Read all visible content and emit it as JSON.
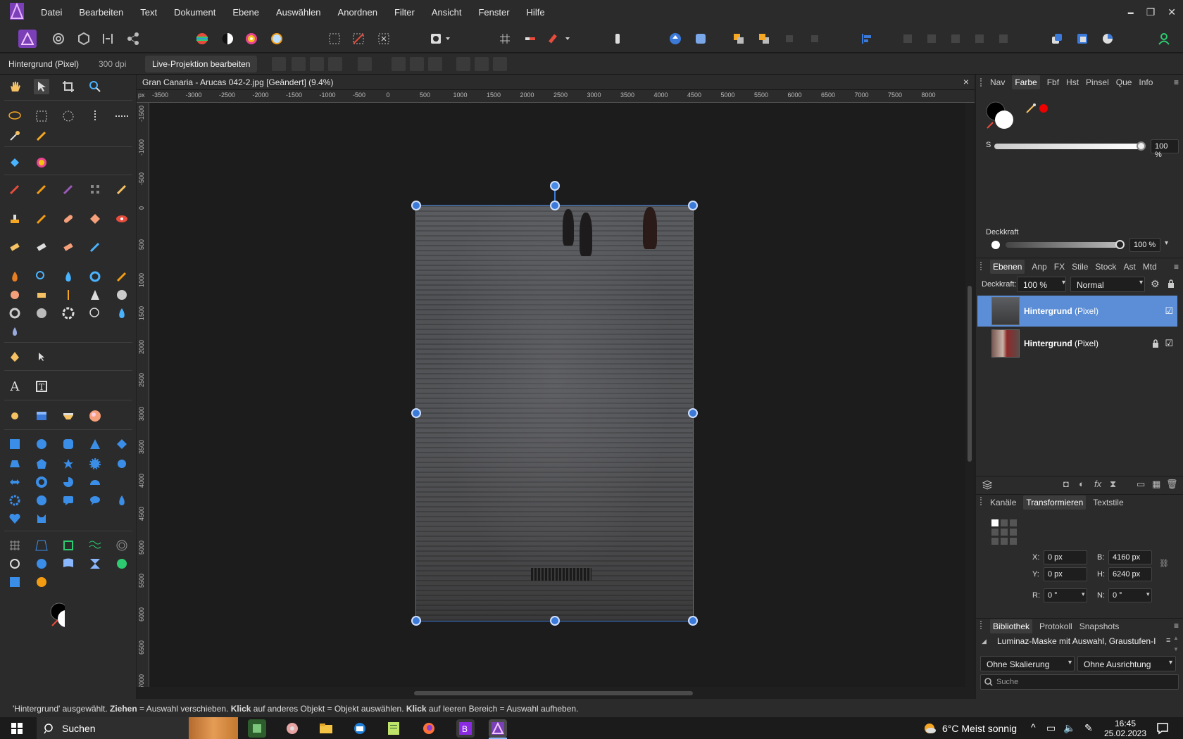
{
  "menubar": {
    "items": [
      "Datei",
      "Bearbeiten",
      "Text",
      "Dokument",
      "Ebene",
      "Auswählen",
      "Anordnen",
      "Filter",
      "Ansicht",
      "Fenster",
      "Hilfe"
    ],
    "minimize": "▬",
    "maximize": "❐",
    "close": "✕"
  },
  "context": {
    "layer_label": "Hintergrund (Pixel)",
    "dpi": "300 dpi",
    "live_button": "Live-Projektion bearbeiten"
  },
  "document": {
    "tab_title": "Gran Canaria - Arucas 042-2.jpg [Geändert] (9.4%)",
    "close": "×",
    "ruler_unit": "px",
    "hruler": [
      "-3500",
      "-3000",
      "-2500",
      "-2000",
      "-1500",
      "-1000",
      "-500",
      "0",
      "500",
      "1000",
      "1500",
      "2000",
      "2500",
      "3000",
      "3500",
      "4000",
      "4500",
      "5000",
      "5500",
      "6000",
      "6500",
      "7000",
      "7500",
      "8000"
    ],
    "vruler": [
      "-1500",
      "-1000",
      "-500",
      "0",
      "500",
      "1000",
      "1500",
      "2000",
      "2500",
      "3000",
      "3500",
      "4000",
      "4500",
      "5000",
      "5500",
      "6000",
      "6500",
      "7000"
    ]
  },
  "colorpanel": {
    "tabs": [
      "Nav",
      "Farbe",
      "Fbf",
      "Hst",
      "Pinsel",
      "Que",
      "Info"
    ],
    "active": "Farbe",
    "s_label": "S",
    "s_value": "100 %",
    "opacity_label": "Deckkraft",
    "opacity_value": "100 %",
    "accent": "#3b7ad9"
  },
  "layers": {
    "tabs": [
      "Ebenen",
      "Anp",
      "FX",
      "Stile",
      "Stock",
      "Ast",
      "Mtd"
    ],
    "active": "Ebenen",
    "opacity_label": "Deckkraft:",
    "opacity_value": "100 %",
    "blend": "Normal",
    "items": [
      {
        "name": "Hintergrund",
        "type": "(Pixel)",
        "selected": true,
        "check": "☑"
      },
      {
        "name": "Hintergrund",
        "type": "(Pixel)",
        "selected": false,
        "locked": true,
        "check": "☑"
      }
    ]
  },
  "transform": {
    "tabs": [
      "Kanäle",
      "Transformieren",
      "Textstile"
    ],
    "active": "Transformieren",
    "x_label": "X:",
    "x": "0 px",
    "y_label": "Y:",
    "y": "0 px",
    "b_label": "B:",
    "b": "4160 px",
    "h_label": "H:",
    "h": "6240 px",
    "r_label": "R:",
    "r": "0 °",
    "n_label": "N:",
    "n": "0 °"
  },
  "library": {
    "tabs": [
      "Bibliothek",
      "Protokoll",
      "Snapshots"
    ],
    "active": "Bibliothek",
    "item": "Luminaz-Maske mit Auswahl, Graustufen-I",
    "scale": "Ohne Skalierung",
    "align": "Ohne Ausrichtung",
    "search_placeholder": "Suche"
  },
  "status": {
    "part1": "'Hintergrund' ausgewählt. ",
    "b1": "Ziehen",
    "part2": " = Auswahl verschieben. ",
    "b2": "Klick",
    "part3": " auf anderes Objekt = Objekt auswählen. ",
    "b3": "Klick",
    "part4": " auf leeren Bereich = Auswahl aufheben."
  },
  "taskbar": {
    "search": "Suchen",
    "weather": "6°C  Meist sonnig",
    "time": "16:45",
    "date": "25.02.2023"
  }
}
